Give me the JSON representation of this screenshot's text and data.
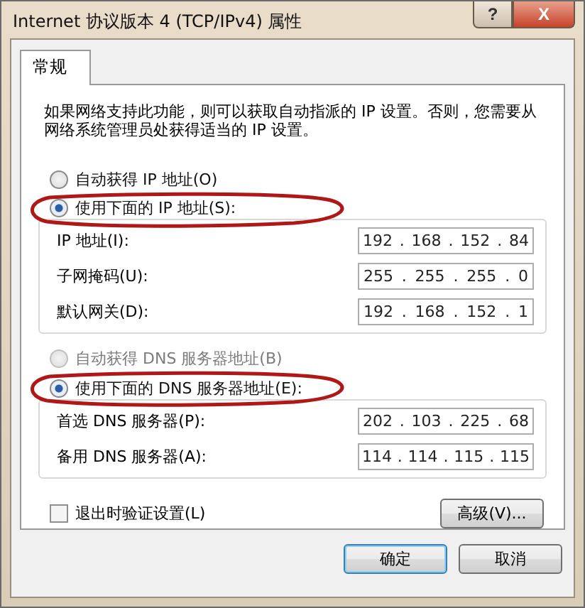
{
  "window": {
    "title": "Internet 协议版本 4 (TCP/IPv4) 属性",
    "help_button": "?",
    "close_button": "X"
  },
  "tabs": [
    {
      "label": "常规",
      "selected": true
    }
  ],
  "description": "如果网络支持此功能，则可以获取自动指派的 IP 设置。否则，您需要从网络系统管理员处获得适当的 IP 设置。",
  "octet_separator": ".",
  "ip_section": {
    "options": [
      {
        "label": "自动获得 IP 地址(O)",
        "selected": false,
        "disabled": false,
        "highlighted": false
      },
      {
        "label": "使用下面的 IP 地址(S):",
        "selected": true,
        "disabled": false,
        "highlighted": true
      }
    ],
    "fields": [
      {
        "label": "IP 地址(I):",
        "octets": [
          "192",
          "168",
          "152",
          "84"
        ]
      },
      {
        "label": "子网掩码(U):",
        "octets": [
          "255",
          "255",
          "255",
          "0"
        ]
      },
      {
        "label": "默认网关(D):",
        "octets": [
          "192",
          "168",
          "152",
          "1"
        ]
      }
    ]
  },
  "dns_section": {
    "options": [
      {
        "label": "自动获得 DNS 服务器地址(B)",
        "selected": false,
        "disabled": true,
        "highlighted": false
      },
      {
        "label": "使用下面的 DNS 服务器地址(E):",
        "selected": true,
        "disabled": false,
        "highlighted": true
      }
    ],
    "fields": [
      {
        "label": "首选 DNS 服务器(P):",
        "octets": [
          "202",
          "103",
          "225",
          "68"
        ]
      },
      {
        "label": "备用 DNS 服务器(A):",
        "octets": [
          "114",
          "114",
          "115",
          "115"
        ]
      }
    ]
  },
  "validate_checkbox": {
    "label": "退出时验证设置(L)",
    "checked": false
  },
  "advanced_button": "高级(V)...",
  "buttons": [
    {
      "label": "确定",
      "default": true
    },
    {
      "label": "取消",
      "default": false
    }
  ]
}
